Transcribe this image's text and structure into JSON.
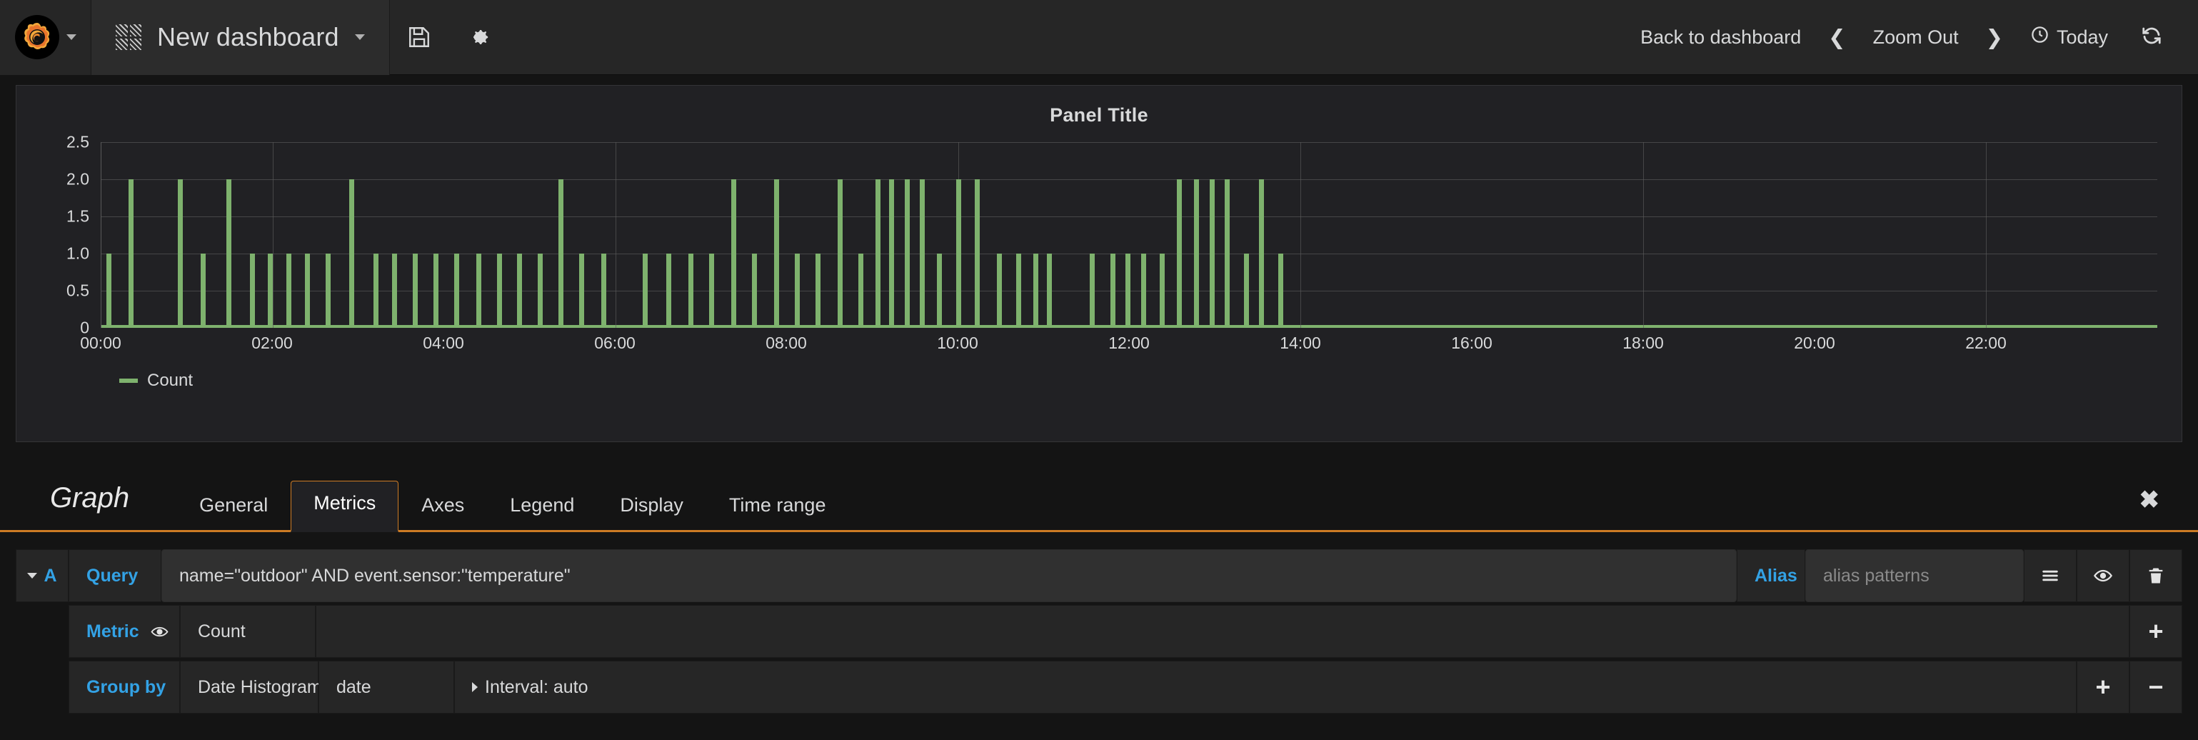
{
  "topnav": {
    "logo_icon": "grafana-logo-icon",
    "logo_caret_icon": "chevron-down-icon",
    "dashboard_grid_icon": "dashboard-grid-icon",
    "dashboard_title": "New dashboard",
    "dashboard_caret_icon": "chevron-down-icon",
    "save_icon": "save-floppy-icon",
    "settings_icon": "gear-icon",
    "back_to_dashboard": "Back to dashboard",
    "time_prev_icon": "chevron-left-icon",
    "zoom_out": "Zoom Out",
    "time_next_icon": "chevron-right-icon",
    "time_range_icon": "clock-icon",
    "time_range": "Today",
    "refresh_icon": "refresh-icon"
  },
  "panel": {
    "title": "Panel Title",
    "legend": [
      {
        "label": "Count",
        "color": "#7eb26d"
      }
    ]
  },
  "chart_data": {
    "type": "bar",
    "title": "Panel Title",
    "xlabel": "",
    "ylabel": "",
    "ylim": [
      0,
      2.5
    ],
    "ytick_labels": [
      "0",
      "0.5",
      "1.0",
      "1.5",
      "2.0",
      "2.5"
    ],
    "yticks": [
      0,
      0.5,
      1.0,
      1.5,
      2.0,
      2.5
    ],
    "xlim": [
      0,
      24
    ],
    "xtick_labels": [
      "00:00",
      "02:00",
      "04:00",
      "06:00",
      "08:00",
      "10:00",
      "12:00",
      "14:00",
      "16:00",
      "18:00",
      "20:00",
      "22:00"
    ],
    "xticks": [
      0,
      2,
      4,
      6,
      8,
      10,
      12,
      14,
      16,
      18,
      20,
      22
    ],
    "grid": true,
    "legend_position": "bottom-left",
    "series": [
      {
        "name": "Count",
        "color": "#7eb26d",
        "points": [
          [
            0.08,
            1
          ],
          [
            0.34,
            2
          ],
          [
            0.92,
            2
          ],
          [
            1.18,
            1
          ],
          [
            1.48,
            2
          ],
          [
            1.76,
            1
          ],
          [
            1.97,
            1
          ],
          [
            2.18,
            1
          ],
          [
            2.4,
            1
          ],
          [
            2.64,
            1
          ],
          [
            2.92,
            2
          ],
          [
            3.2,
            1
          ],
          [
            3.42,
            1
          ],
          [
            3.66,
            1
          ],
          [
            3.9,
            1
          ],
          [
            4.14,
            1
          ],
          [
            4.4,
            1
          ],
          [
            4.64,
            1
          ],
          [
            4.88,
            1
          ],
          [
            5.12,
            1
          ],
          [
            5.36,
            2
          ],
          [
            5.6,
            1
          ],
          [
            5.86,
            1
          ],
          [
            6.34,
            1
          ],
          [
            6.62,
            1
          ],
          [
            6.88,
            1
          ],
          [
            7.12,
            1
          ],
          [
            7.38,
            2
          ],
          [
            7.62,
            1
          ],
          [
            7.88,
            2
          ],
          [
            8.12,
            1
          ],
          [
            8.36,
            1
          ],
          [
            8.62,
            2
          ],
          [
            8.86,
            1
          ],
          [
            9.06,
            2
          ],
          [
            9.22,
            2
          ],
          [
            9.4,
            2
          ],
          [
            9.58,
            2
          ],
          [
            9.78,
            1
          ],
          [
            10.0,
            2
          ],
          [
            10.22,
            2
          ],
          [
            10.48,
            1
          ],
          [
            10.7,
            1
          ],
          [
            10.9,
            1
          ],
          [
            11.06,
            1
          ],
          [
            11.56,
            1
          ],
          [
            11.8,
            1
          ],
          [
            11.98,
            1
          ],
          [
            12.16,
            1
          ],
          [
            12.38,
            1
          ],
          [
            12.58,
            2
          ],
          [
            12.78,
            2
          ],
          [
            12.96,
            2
          ],
          [
            13.14,
            2
          ],
          [
            13.36,
            1
          ],
          [
            13.54,
            2
          ],
          [
            13.76,
            1
          ]
        ]
      }
    ]
  },
  "editor": {
    "kind": "Graph",
    "tabs": [
      {
        "label": "General",
        "active": false
      },
      {
        "label": "Metrics",
        "active": true
      },
      {
        "label": "Axes",
        "active": false
      },
      {
        "label": "Legend",
        "active": false
      },
      {
        "label": "Display",
        "active": false
      },
      {
        "label": "Time range",
        "active": false
      }
    ],
    "close_icon": "close-icon",
    "query_row": {
      "ref_caret_icon": "chevron-down-icon",
      "ref_id": "A",
      "query_label": "Query",
      "query_value": "name=\"outdoor\" AND event.sensor:\"temperature\"",
      "alias_label": "Alias",
      "alias_value": "",
      "alias_placeholder": "alias patterns",
      "menu_icon": "hamburger-menu-icon",
      "eye_icon": "eye-icon",
      "trash_icon": "trash-icon"
    },
    "metric_row": {
      "label": "Metric",
      "eye_icon": "eye-icon",
      "value": "Count",
      "add_label": "+"
    },
    "groupby_row": {
      "label": "Group by",
      "type": "Date Histogram",
      "field": "date",
      "interval_caret_icon": "chevron-right-icon",
      "interval": "Interval: auto",
      "add_label": "+",
      "remove_label": "−"
    }
  },
  "colors": {
    "accent_orange": "#cc7b25",
    "link_blue": "#33a2e5",
    "series_green": "#7eb26d",
    "panel_bg": "#212124",
    "app_bg": "#141414"
  }
}
